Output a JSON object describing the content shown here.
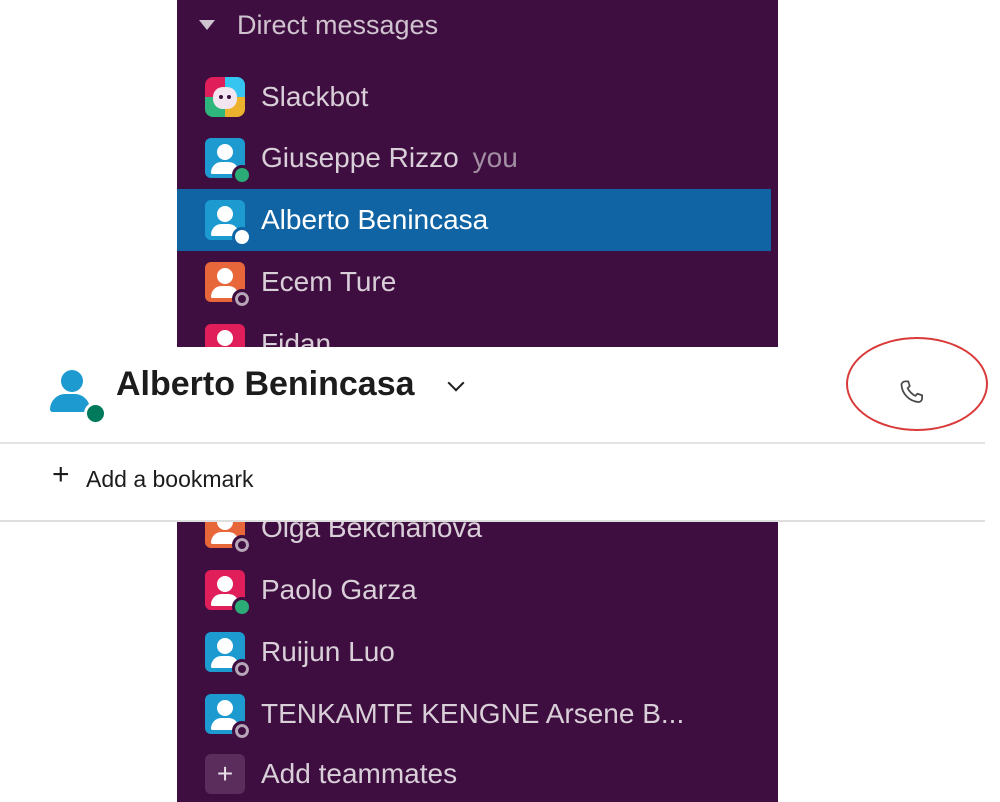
{
  "sidebar": {
    "section_title": "Direct messages",
    "items": [
      {
        "name": "Slackbot",
        "avatar": "slackbot-logo-icon"
      },
      {
        "name": "Giuseppe Rizzo",
        "suffix": "you",
        "avatar_color": "#1d9bd1",
        "presence": "online"
      },
      {
        "name": "Alberto Benincasa",
        "avatar_color": "#1d9bd1",
        "presence": "active",
        "selected": true
      },
      {
        "name": "Ecem Ture",
        "avatar_color": "#e8673a",
        "presence": "away"
      },
      {
        "name": "Fidan",
        "avatar_color": "#e01e5a",
        "presence": "away"
      },
      {
        "name": "Olga Bekchanova",
        "avatar_color": "#e8673a",
        "presence": "away"
      },
      {
        "name": "Paolo Garza",
        "avatar_color": "#e01e5a",
        "presence": "online"
      },
      {
        "name": "Ruijun Luo",
        "avatar_color": "#1d9bd1",
        "presence": "away"
      },
      {
        "name": "TENKAMTE KENGNE Arsene B...",
        "avatar_color": "#1d9bd1",
        "presence": "away"
      }
    ],
    "add_teammates_label": "Add teammates"
  },
  "conversation": {
    "title": "Alberto Benincasa",
    "call_button": "phone-icon",
    "bookmark_plus": "+",
    "bookmark_label": "Add a bookmark"
  },
  "colors": {
    "sidebar_bg": "#3f0e40",
    "selected_bg": "#1164a3",
    "online": "#2bac76",
    "highlight_ring": "#d93a3a"
  }
}
